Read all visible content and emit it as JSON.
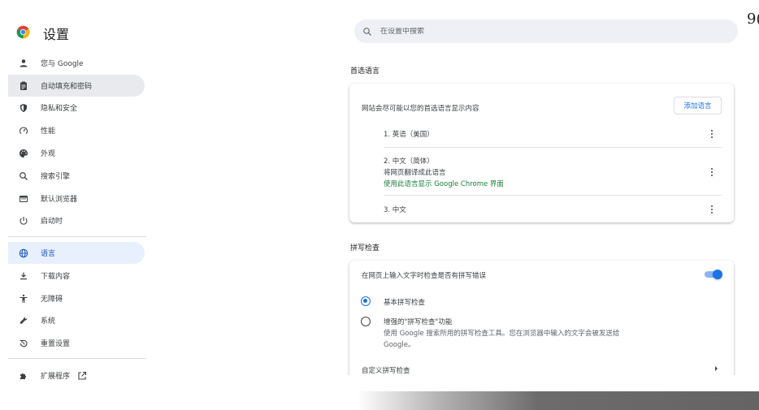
{
  "header": {
    "title": "设置",
    "search_placeholder": "在设置中搜索",
    "corner_text": "9("
  },
  "sidebar": {
    "items": [
      {
        "label": "您与 Google",
        "icon": "person-icon"
      },
      {
        "label": "自动填充和密码",
        "icon": "clipboard-icon"
      },
      {
        "label": "隐私和安全",
        "icon": "shield-icon"
      },
      {
        "label": "性能",
        "icon": "speedometer-icon"
      },
      {
        "label": "外观",
        "icon": "palette-icon"
      },
      {
        "label": "搜索引擎",
        "icon": "search-icon"
      },
      {
        "label": "默认浏览器",
        "icon": "browser-window-icon"
      },
      {
        "label": "启动时",
        "icon": "power-icon"
      },
      {
        "label": "语言",
        "icon": "globe-icon"
      },
      {
        "label": "下载内容",
        "icon": "download-icon"
      },
      {
        "label": "无障碍",
        "icon": "accessibility-icon"
      },
      {
        "label": "系统",
        "icon": "wrench-icon"
      },
      {
        "label": "重置设置",
        "icon": "reset-history-icon"
      },
      {
        "label": "扩展程序",
        "icon": "puzzle-icon"
      }
    ]
  },
  "languages": {
    "section_title": "首选语言",
    "description": "网站会尽可能以您的首选语言显示内容",
    "add_button": "添加语言",
    "items": [
      {
        "name": "1. 英语（美国）"
      },
      {
        "name": "2. 中文（简体）",
        "sub": "将网页翻译成此语言",
        "note": "使用此语言显示 Google Chrome 界面"
      },
      {
        "name": "3. 中文"
      }
    ]
  },
  "spellcheck": {
    "section_title": "拼写检查",
    "toggle_label": "在网页上输入文字时检查是否有拼写错误",
    "toggle_on": true,
    "options": [
      {
        "label": "基本拼写检查",
        "selected": true
      },
      {
        "label": "增强的\"拼写检查\"功能",
        "desc_line1": "使用 Google 搜索所用的拼写检查工具。您在浏览器中输入的文字会被发送给",
        "desc_line2": "Google。",
        "selected": false
      }
    ],
    "custom_label": "自定义拼写检查"
  },
  "colors": {
    "accent": "#1a73e8",
    "active_nav_bg": "#e8f0fe",
    "hover_nav_bg": "#e8eaed",
    "green_note": "#188038"
  }
}
